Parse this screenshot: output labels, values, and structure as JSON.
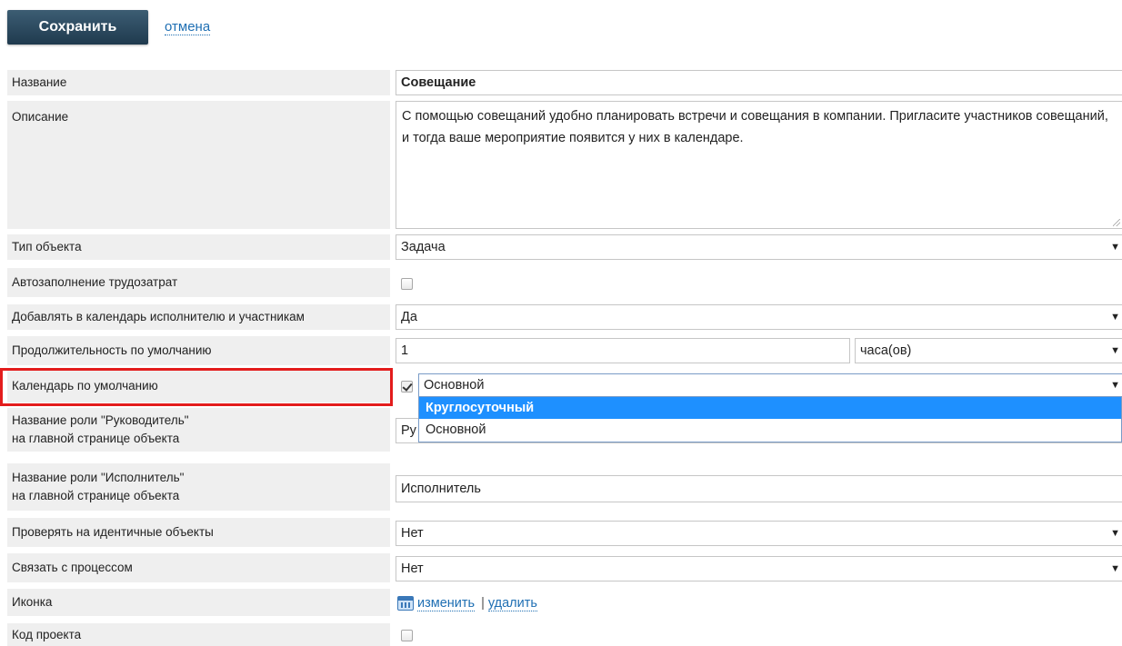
{
  "toolbar": {
    "save_label": "Сохранить",
    "cancel_label": "отмена"
  },
  "fields": {
    "name": {
      "label": "Название",
      "value": "Совещание"
    },
    "description": {
      "label": "Описание",
      "value": "С помощью совещаний удобно планировать встречи и совещания в компании. Пригласите участников совещаний, и тогда ваше мероприятие появится у них в календаре."
    },
    "object_type": {
      "label": "Тип объекта",
      "value": "Задача"
    },
    "autofill": {
      "label": "Автозаполнение трудозатрат",
      "checked": false
    },
    "add_to_calendar": {
      "label": "Добавлять в календарь исполнителю и участникам",
      "value": "Да"
    },
    "duration": {
      "label": "Продолжительность по умолчанию",
      "value": "1",
      "unit": "часа(ов)"
    },
    "default_calendar": {
      "label": "Календарь по умолчанию",
      "checked": true,
      "value": "Основной",
      "options": [
        "Круглосуточный",
        "Основной"
      ],
      "highlighted_option": "Круглосуточный"
    },
    "manager_role": {
      "label_line1": "Название роли \"Руководитель\"",
      "label_line2": "на главной странице объекта",
      "value_visible": "Ру"
    },
    "executor_role": {
      "label_line1": "Название роли \"Исполнитель\"",
      "label_line2": "на главной странице объекта",
      "value": "Исполнитель"
    },
    "check_identical": {
      "label": "Проверять на идентичные объекты",
      "value": "Нет"
    },
    "link_process": {
      "label": "Связать с процессом",
      "value": "Нет"
    },
    "icon": {
      "label": "Иконка",
      "change_label": "изменить",
      "separator": "|",
      "delete_label": "удалить"
    },
    "project_code": {
      "label": "Код проекта",
      "checked": false
    }
  },
  "colors": {
    "highlight_border": "#e31c1c",
    "dropdown_active": "#1e90ff",
    "link": "#1f6fb3",
    "save_button": "#2b4a60"
  }
}
